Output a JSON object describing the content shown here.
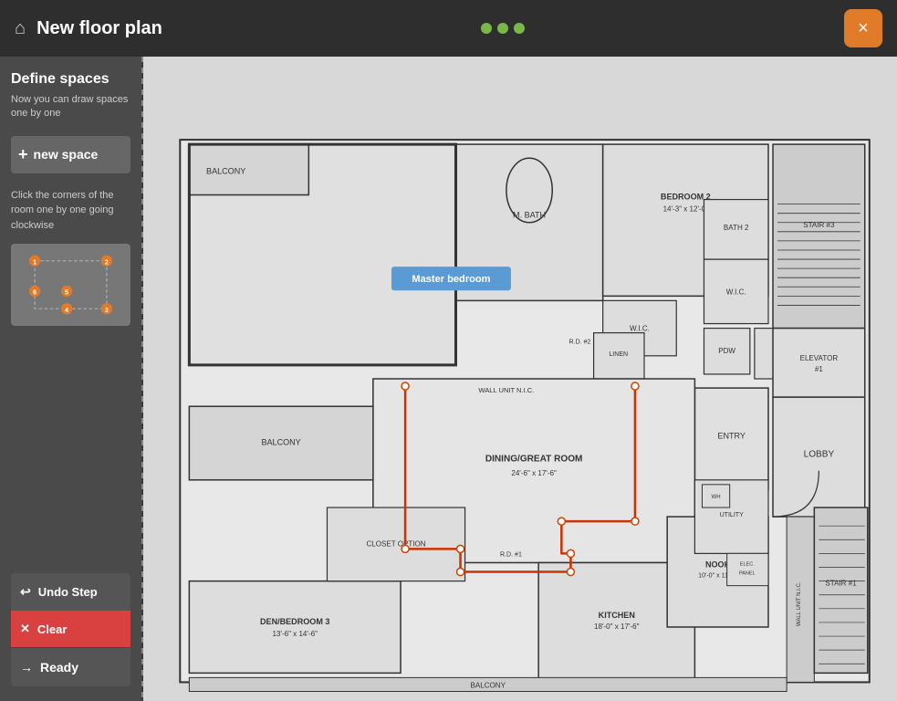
{
  "topbar": {
    "title": "New floor plan",
    "close_label": "×",
    "dots": [
      "green",
      "green",
      "green"
    ]
  },
  "sidebar": {
    "title": "Define spaces",
    "description": "Now you can draw spaces one by one",
    "new_space_label": "new space",
    "instruction": "Click the corners of the room one by one going clockwise",
    "corner_numbers": [
      "1",
      "2",
      "3",
      "4",
      "5",
      "6"
    ],
    "undo_label": "Undo Step",
    "clear_label": "Clear",
    "ready_label": "Ready"
  },
  "floorplan": {
    "master_bedroom_label": "Master bedroom",
    "rooms": [
      "BALCONY",
      "M. BATH",
      "BEDROOM 2",
      "STAIR #3",
      "ELEVATOR #1",
      "W.I.C.",
      "BATH 2",
      "PDW",
      "CLOSET",
      "LOBBY",
      "DINING/GREAT ROOM",
      "ENTRY",
      "KITCHEN",
      "NOOK",
      "DEN/BEDROOM 3",
      "CLOSET OPTION",
      "WALL UNIT N.I.C.",
      "STAIR #1"
    ]
  },
  "colors": {
    "accent_orange": "#e07b2a",
    "accent_red": "#d94040",
    "accent_blue": "#5b9bd5",
    "dark_bg": "#2e2e2e",
    "sidebar_bg": "#4a4a4a",
    "dot_green": "#7ab648",
    "draw_red": "#cc3300"
  }
}
